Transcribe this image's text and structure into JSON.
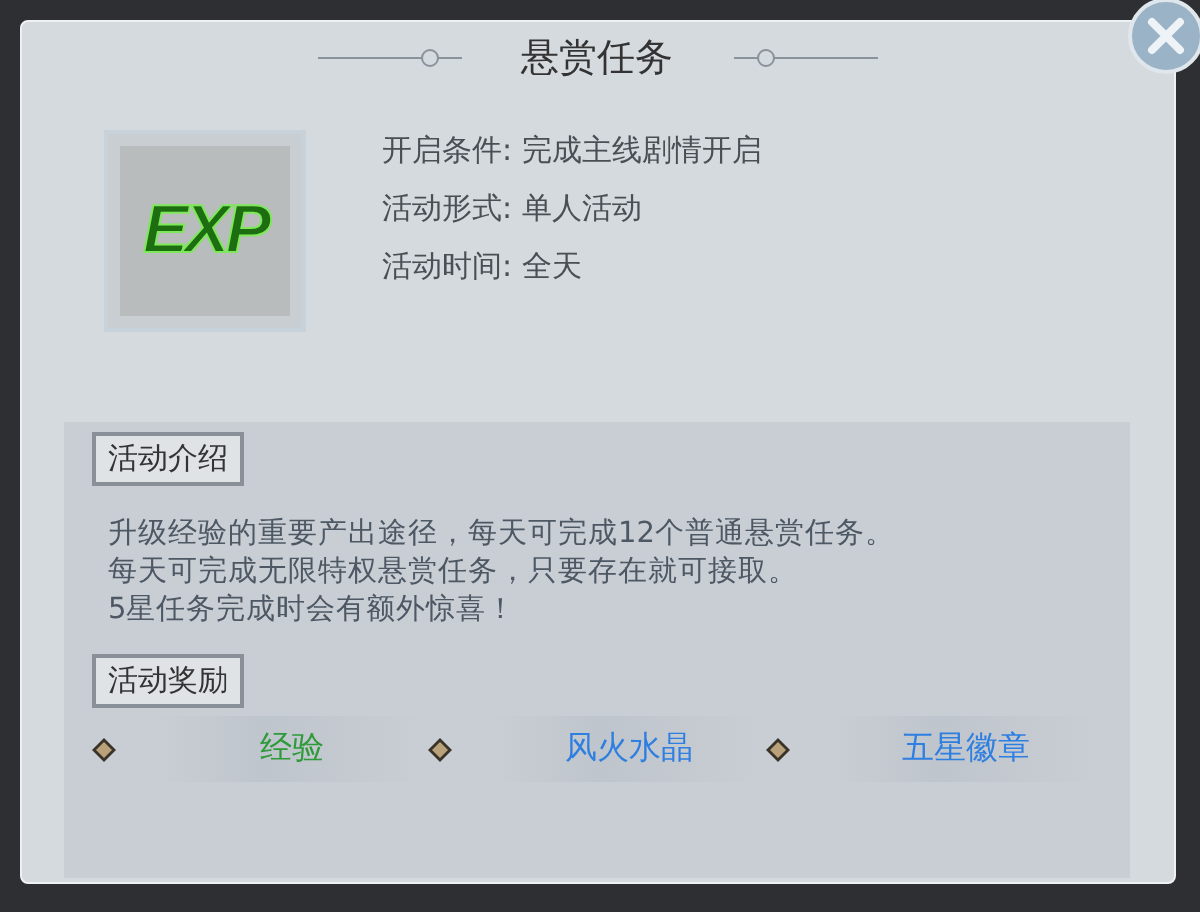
{
  "dialog": {
    "title": "悬赏任务"
  },
  "icon": {
    "text": "EXP"
  },
  "info": [
    {
      "label": "开启条件:",
      "value": "完成主线剧情开启"
    },
    {
      "label": "活动形式:",
      "value": "单人活动"
    },
    {
      "label": "活动时间:",
      "value": "全天"
    }
  ],
  "intro": {
    "heading": "活动介绍",
    "lines": [
      "升级经验的重要产出途径，每天可完成12个普通悬赏任务。",
      "每天可完成无限特权悬赏任务，只要存在就可接取。",
      "5星任务完成时会有额外惊喜！"
    ]
  },
  "rewards": {
    "heading": "活动奖励",
    "items": [
      {
        "name": "经验",
        "color": "#2e9a3a"
      },
      {
        "name": "风火水晶",
        "color": "#2f7fe0"
      },
      {
        "name": "五星徽章",
        "color": "#2f7fe0"
      }
    ]
  }
}
